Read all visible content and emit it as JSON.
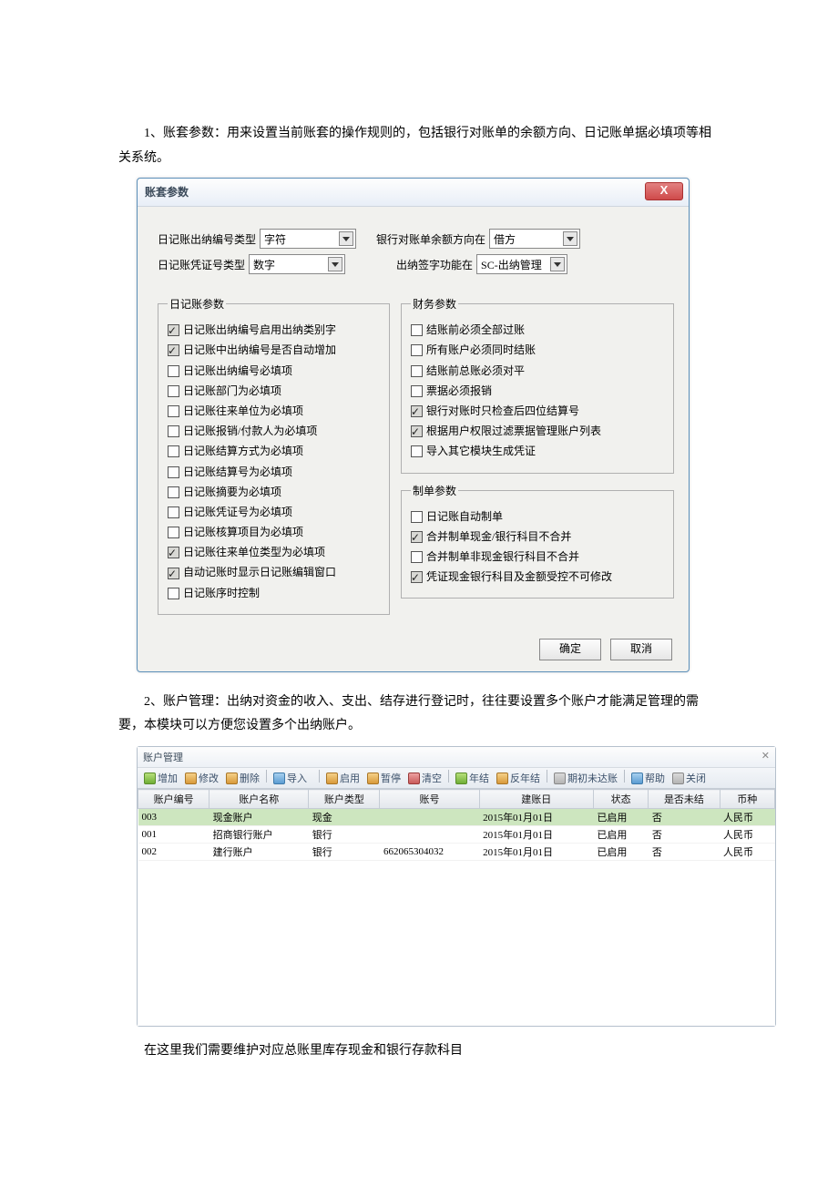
{
  "para1": "1、账套参数：用来设置当前账套的操作规则的，包括银行对账单的余额方向、日记账单据必填项等相关系统。",
  "dialog1": {
    "title": "账套参数",
    "close": "X",
    "fields": {
      "journalNumType": {
        "label": "日记账出纳编号类型",
        "value": "字符"
      },
      "voucherNumType": {
        "label": "日记账凭证号类型",
        "value": "数字"
      },
      "balanceDirection": {
        "label": "银行对账单余额方向在",
        "value": "借方"
      },
      "signatureFunc": {
        "label": "出纳签字功能在",
        "value": "SC-出纳管理"
      }
    },
    "journalGroup": {
      "legend": "日记账参数",
      "items": [
        {
          "checked": true,
          "label": "日记账出纳编号启用出纳类别字"
        },
        {
          "checked": true,
          "label": "日记账中出纳编号是否自动增加"
        },
        {
          "checked": false,
          "label": "日记账出纳编号必填项"
        },
        {
          "checked": false,
          "label": "日记账部门为必填项"
        },
        {
          "checked": false,
          "label": "日记账往来单位为必填项"
        },
        {
          "checked": false,
          "label": "日记账报销/付款人为必填项"
        },
        {
          "checked": false,
          "label": "日记账结算方式为必填项"
        },
        {
          "checked": false,
          "label": "日记账结算号为必填项"
        },
        {
          "checked": false,
          "label": "日记账摘要为必填项"
        },
        {
          "checked": false,
          "label": "日记账凭证号为必填项"
        },
        {
          "checked": false,
          "label": "日记账核算项目为必填项"
        },
        {
          "checked": true,
          "label": "日记账往来单位类型为必填项"
        },
        {
          "checked": true,
          "label": "自动记账时显示日记账编辑窗口"
        },
        {
          "checked": false,
          "label": "日记账序时控制"
        }
      ]
    },
    "financeGroup": {
      "legend": "财务参数",
      "items": [
        {
          "checked": false,
          "label": "结账前必须全部过账"
        },
        {
          "checked": false,
          "label": "所有账户必须同时结账"
        },
        {
          "checked": false,
          "label": "结账前总账必须对平"
        },
        {
          "checked": false,
          "label": "票据必须报销"
        },
        {
          "checked": true,
          "label": "银行对账时只检查后四位结算号"
        },
        {
          "checked": true,
          "label": "根据用户权限过滤票据管理账户列表"
        },
        {
          "checked": false,
          "label": "导入其它模块生成凭证"
        }
      ]
    },
    "orderGroup": {
      "legend": "制单参数",
      "items": [
        {
          "checked": false,
          "label": "日记账自动制单"
        },
        {
          "checked": true,
          "label": "合并制单现金/银行科目不合并"
        },
        {
          "checked": false,
          "label": "合并制单非现金银行科目不合并"
        },
        {
          "checked": true,
          "label": "凭证现金银行科目及金额受控不可修改"
        }
      ]
    },
    "buttons": {
      "ok": "确定",
      "cancel": "取消"
    }
  },
  "para2": "2、账户管理：出纳对资金的收入、支出、结存进行登记时，往往要设置多个账户才能满足管理的需要，本模块可以方便您设置多个出纳账户。",
  "acctDialog": {
    "title": "账户管理",
    "close": "✕",
    "toolbar": [
      {
        "ico": "green",
        "label": "增加"
      },
      {
        "ico": "orange",
        "label": "修改"
      },
      {
        "ico": "orange",
        "label": "删除"
      },
      {
        "sep": true
      },
      {
        "ico": "blue",
        "label": "导入"
      },
      {
        "_gap": true
      },
      {
        "sep": true
      },
      {
        "ico": "orange",
        "label": "启用"
      },
      {
        "ico": "orange",
        "label": "暂停"
      },
      {
        "ico": "red",
        "label": "清空"
      },
      {
        "sep": true
      },
      {
        "ico": "green",
        "label": "年结"
      },
      {
        "ico": "orange",
        "label": "反年结"
      },
      {
        "sep": true
      },
      {
        "ico": "gray",
        "label": "期初未达账"
      },
      {
        "sep": true
      },
      {
        "ico": "blue",
        "label": "帮助"
      },
      {
        "ico": "gray",
        "label": "关闭"
      }
    ],
    "columns": [
      "账户编号",
      "账户名称",
      "账户类型",
      "账号",
      "建账日",
      "状态",
      "是否未结",
      "币种"
    ],
    "rows": [
      {
        "sel": true,
        "c": [
          "003",
          "现金账户",
          "现金",
          "",
          "2015年01月01日",
          "已启用",
          "否",
          "人民币"
        ]
      },
      {
        "sel": false,
        "c": [
          "001",
          "招商银行账户",
          "银行",
          "",
          "2015年01月01日",
          "已启用",
          "否",
          "人民币"
        ]
      },
      {
        "sel": false,
        "c": [
          "002",
          "建行账户",
          "银行",
          "662065304032",
          "2015年01月01日",
          "已启用",
          "否",
          "人民币"
        ]
      }
    ]
  },
  "para3": "在这里我们需要维护对应总账里库存现金和银行存款科目"
}
